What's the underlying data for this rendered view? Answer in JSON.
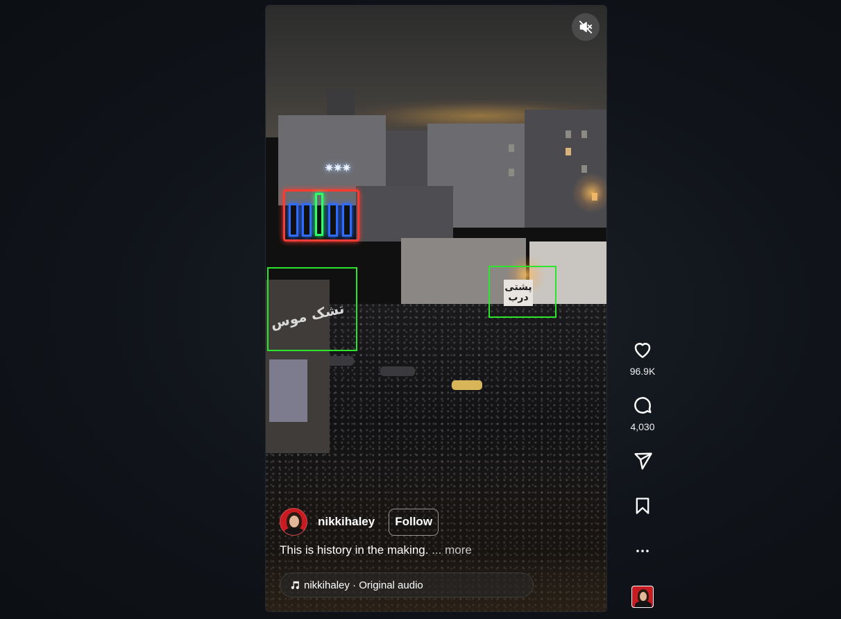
{
  "reel": {
    "author": {
      "username": "nikkihaley",
      "follow_label": "Follow"
    },
    "caption": {
      "text": "This is history in the making.",
      "more_label": "... more"
    },
    "audio": {
      "label": "nikkihaley · Original audio",
      "icon": "music-note-icon"
    },
    "mute_icon": "speaker-muted-icon",
    "scene_signs": {
      "left_sign": "تشک موس",
      "right_sign_line1": "پشتی",
      "right_sign_line2": "درب"
    },
    "highlight_color": "#2ce62c"
  },
  "actions": {
    "likes": "96.9K",
    "comments": "4,030",
    "icons": [
      "heart-icon",
      "comment-icon",
      "share-icon",
      "bookmark-icon",
      "more-icon"
    ]
  },
  "colors": {
    "background": "#0f1216",
    "text": "#ffffff",
    "avatar_bg": "#c91b22"
  }
}
